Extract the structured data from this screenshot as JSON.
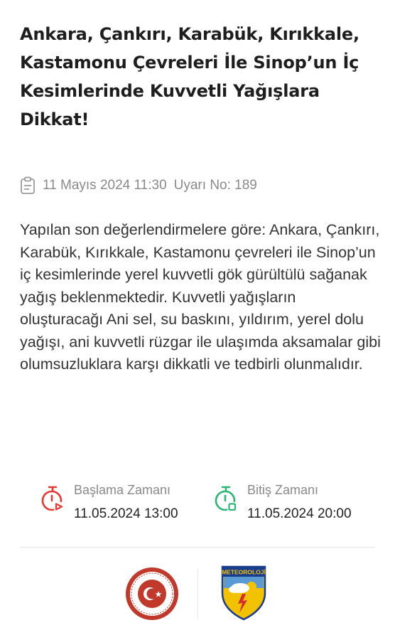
{
  "alert": {
    "title": "Ankara, Çankırı, Karabük, Kırıkkale, Kastamonu Çevreleri İle Sinop’un İç Kesimlerinde Kuvvetli  Yağışlara Dikkat!",
    "date": "11 Mayıs 2024 11:30",
    "warning_no": "Uyarı No: 189",
    "body": "Yapılan son değerlendirmelere göre: Ankara, Çankırı, Karabük, Kırıkkale, Kastamonu çevreleri ile Sinop’un iç kesimlerinde yerel kuvvetli gök gürültülü sağanak yağış beklenmektedir. Kuvvetli yağışların oluşturacağı Ani sel, su baskını, yıldırım, yerel dolu yağışı, ani kuvvetli rüzgar ile ulaşımda aksamalar gibi olumsuzluklara karşı dikkatli ve tedbirli olunmalıdır."
  },
  "start": {
    "label": "Başlama Zamanı",
    "value": "11.05.2024 13:00",
    "color": "#e53935",
    "icon": "stopwatch-start-icon"
  },
  "end": {
    "label": "Bitiş Zamanı",
    "value": "11.05.2024 20:00",
    "color": "#2bb673",
    "icon": "stopwatch-end-icon"
  },
  "logos": {
    "ministry_logo": "ministry-seal-logo",
    "meteoroloji_text": "METEOROLOJİ"
  }
}
